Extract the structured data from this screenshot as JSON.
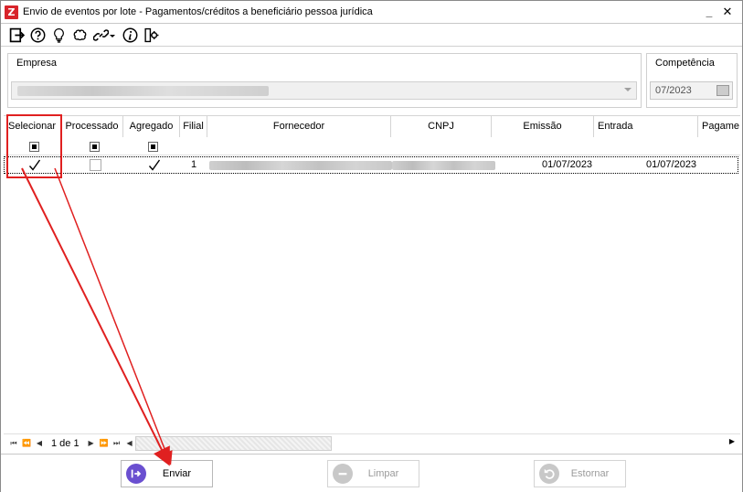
{
  "window": {
    "title": "Envio de eventos por lote - Pagamentos/créditos a beneficiário pessoa jurídica",
    "app_logo_glyph": "Z",
    "minimize_glyph": "_",
    "close_glyph": "✕"
  },
  "toolbar": {
    "icons": [
      "exit-icon",
      "help-icon",
      "lightbulb-icon",
      "brain-icon",
      "link-icon",
      "info-icon",
      "settings-icon"
    ]
  },
  "empresa": {
    "label": "Empresa",
    "value_redacted": true
  },
  "competencia": {
    "label": "Competência",
    "value": "07/2023"
  },
  "grid": {
    "columns": [
      "Selecionar",
      "Processado",
      "Agregado",
      "Filial",
      "Fornecedor",
      "CNPJ",
      "Emissão",
      "Entrada",
      "Pagame"
    ],
    "rows": [
      {
        "selecionar": true,
        "processado": false,
        "agregado": true,
        "filial": "1",
        "fornecedor_redacted": true,
        "cnpj_redacted": true,
        "emissao": "01/07/2023",
        "entrada": "01/07/2023"
      }
    ]
  },
  "pager": {
    "text": "1 de 1"
  },
  "footer": {
    "enviar": "Enviar",
    "limpar": "Limpar",
    "estornar": "Estornar"
  },
  "colors": {
    "accent_red": "#d8232a",
    "highlight": "#e02020",
    "enviar_icon": "#6a4fd0"
  }
}
